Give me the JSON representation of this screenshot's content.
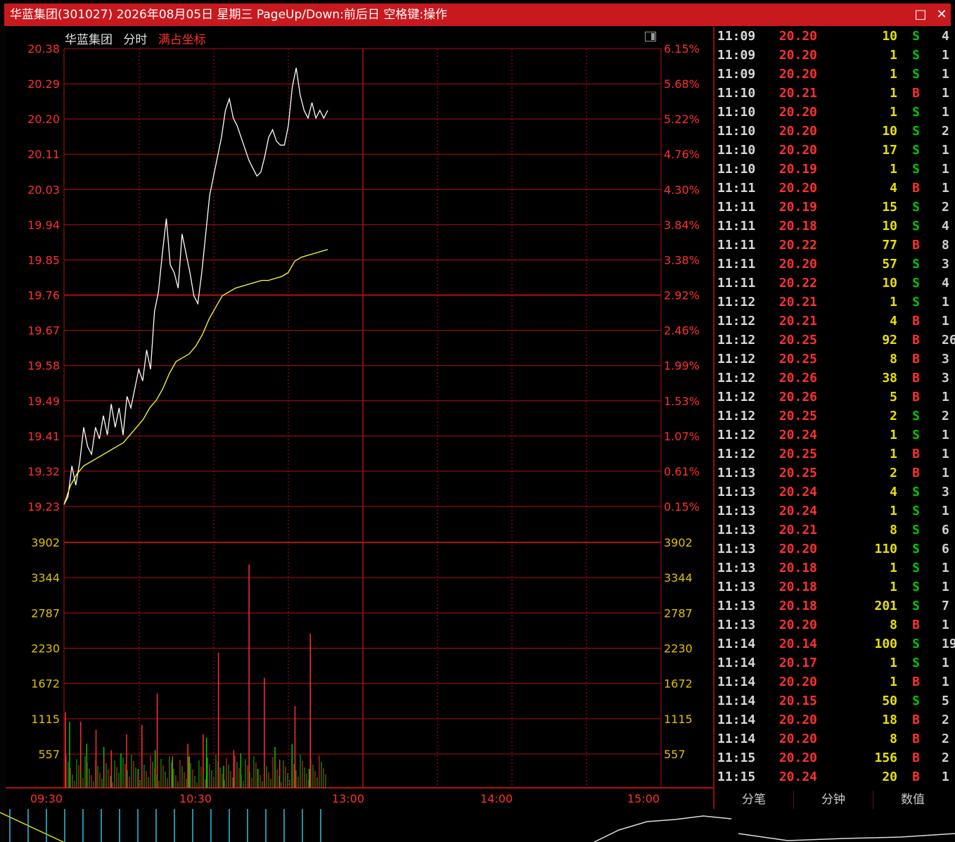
{
  "window": {
    "title": "华蓝集团(301027) 2026年08月05日 星期三 PageUp/Down:前后日 空格键:操作",
    "maximize_icon": "□",
    "close_icon": "✕"
  },
  "chart_header": {
    "name": "华蓝集团",
    "mode": "分时",
    "option": "满占坐标"
  },
  "colors": {
    "up": "#ff3030",
    "down": "#00c800",
    "price_line": "#ffffff",
    "avg_line": "#ffff30",
    "grid": "#b01010",
    "axis_text": "#ff3030",
    "vol_text": "#e0c000"
  },
  "chart_data": {
    "type": "line",
    "price_axis_labels": [
      "20.38",
      "20.29",
      "20.20",
      "20.11",
      "20.03",
      "19.94",
      "19.85",
      "19.76",
      "19.67",
      "19.58",
      "19.49",
      "19.41",
      "19.32",
      "19.23"
    ],
    "pct_axis_labels": [
      "6.15%",
      "5.68%",
      "5.22%",
      "4.76%",
      "4.30%",
      "3.84%",
      "3.38%",
      "2.92%",
      "2.46%",
      "1.99%",
      "1.53%",
      "1.07%",
      "0.61%",
      "0.15%"
    ],
    "volume_axis_labels": [
      "3902",
      "3344",
      "2787",
      "2230",
      "1672",
      "1115",
      "557"
    ],
    "time_labels": [
      "09:30",
      "10:30",
      "13:00",
      "14:00",
      "15:00"
    ],
    "ylim": [
      19.195,
      20.38
    ],
    "volume_max": 3902,
    "price": [
      19.2,
      19.22,
      19.3,
      19.25,
      19.31,
      19.4,
      19.35,
      19.33,
      19.4,
      19.37,
      19.43,
      19.38,
      19.46,
      19.4,
      19.45,
      19.38,
      19.48,
      19.45,
      19.5,
      19.55,
      19.52,
      19.6,
      19.55,
      19.7,
      19.75,
      19.85,
      19.94,
      19.82,
      19.8,
      19.76,
      19.9,
      19.85,
      19.8,
      19.74,
      19.72,
      19.8,
      19.9,
      20.0,
      20.05,
      20.1,
      20.15,
      20.22,
      20.25,
      20.2,
      20.18,
      20.15,
      20.12,
      20.09,
      20.07,
      20.05,
      20.06,
      20.1,
      20.15,
      20.17,
      20.14,
      20.13,
      20.13,
      20.18,
      20.28,
      20.33,
      20.26,
      20.22,
      20.2,
      20.24,
      20.2,
      20.22,
      20.2,
      20.22
    ],
    "avg": [
      19.2,
      19.25,
      19.28,
      19.3,
      19.31,
      19.32,
      19.33,
      19.34,
      19.35,
      19.36,
      19.38,
      19.4,
      19.42,
      19.45,
      19.47,
      19.5,
      19.54,
      19.57,
      19.58,
      19.59,
      19.61,
      19.64,
      19.68,
      19.71,
      19.74,
      19.75,
      19.76,
      19.765,
      19.77,
      19.775,
      19.78,
      19.78,
      19.785,
      19.79,
      19.8,
      19.83,
      19.84,
      19.845,
      19.85,
      19.855,
      19.86
    ],
    "volume_up": [
      1200,
      1050,
      920,
      600,
      850,
      1000,
      1500,
      500,
      700,
      850,
      2150,
      600,
      3550,
      1750,
      450,
      1300,
      2450
    ],
    "volume_down": [
      1050,
      700,
      650,
      550,
      300,
      600,
      450,
      500,
      800,
      350,
      550,
      300,
      650,
      700,
      300
    ]
  },
  "ticks": [
    {
      "time": "11:09",
      "price": "20.20",
      "vol": "10",
      "dir": "S",
      "num": "4"
    },
    {
      "time": "11:09",
      "price": "20.20",
      "vol": "1",
      "dir": "S",
      "num": "1"
    },
    {
      "time": "11:09",
      "price": "20.20",
      "vol": "1",
      "dir": "S",
      "num": "1"
    },
    {
      "time": "11:10",
      "price": "20.21",
      "vol": "1",
      "dir": "B",
      "num": "1"
    },
    {
      "time": "11:10",
      "price": "20.20",
      "vol": "1",
      "dir": "S",
      "num": "1"
    },
    {
      "time": "11:10",
      "price": "20.20",
      "vol": "10",
      "dir": "S",
      "num": "2"
    },
    {
      "time": "11:10",
      "price": "20.20",
      "vol": "17",
      "dir": "S",
      "num": "1"
    },
    {
      "time": "11:10",
      "price": "20.19",
      "vol": "1",
      "dir": "S",
      "num": "1"
    },
    {
      "time": "11:11",
      "price": "20.20",
      "vol": "4",
      "dir": "B",
      "num": "1"
    },
    {
      "time": "11:11",
      "price": "20.19",
      "vol": "15",
      "dir": "S",
      "num": "2"
    },
    {
      "time": "11:11",
      "price": "20.18",
      "vol": "10",
      "dir": "S",
      "num": "4"
    },
    {
      "time": "11:11",
      "price": "20.22",
      "vol": "77",
      "dir": "B",
      "num": "8"
    },
    {
      "time": "11:11",
      "price": "20.20",
      "vol": "57",
      "dir": "S",
      "num": "3"
    },
    {
      "time": "11:11",
      "price": "20.22",
      "vol": "10",
      "dir": "S",
      "num": "4"
    },
    {
      "time": "11:12",
      "price": "20.21",
      "vol": "1",
      "dir": "S",
      "num": "1"
    },
    {
      "time": "11:12",
      "price": "20.21",
      "vol": "4",
      "dir": "B",
      "num": "1"
    },
    {
      "time": "11:12",
      "price": "20.25",
      "vol": "92",
      "dir": "B",
      "num": "26"
    },
    {
      "time": "11:12",
      "price": "20.25",
      "vol": "8",
      "dir": "B",
      "num": "3"
    },
    {
      "time": "11:12",
      "price": "20.26",
      "vol": "38",
      "dir": "B",
      "num": "3"
    },
    {
      "time": "11:12",
      "price": "20.26",
      "vol": "5",
      "dir": "B",
      "num": "1"
    },
    {
      "time": "11:12",
      "price": "20.25",
      "vol": "2",
      "dir": "S",
      "num": "2"
    },
    {
      "time": "11:12",
      "price": "20.24",
      "vol": "1",
      "dir": "S",
      "num": "1"
    },
    {
      "time": "11:12",
      "price": "20.25",
      "vol": "1",
      "dir": "B",
      "num": "1"
    },
    {
      "time": "11:13",
      "price": "20.25",
      "vol": "2",
      "dir": "B",
      "num": "1"
    },
    {
      "time": "11:13",
      "price": "20.24",
      "vol": "4",
      "dir": "S",
      "num": "3"
    },
    {
      "time": "11:13",
      "price": "20.24",
      "vol": "1",
      "dir": "S",
      "num": "1"
    },
    {
      "time": "11:13",
      "price": "20.21",
      "vol": "8",
      "dir": "S",
      "num": "6"
    },
    {
      "time": "11:13",
      "price": "20.20",
      "vol": "110",
      "dir": "S",
      "num": "6"
    },
    {
      "time": "11:13",
      "price": "20.18",
      "vol": "1",
      "dir": "S",
      "num": "1"
    },
    {
      "time": "11:13",
      "price": "20.18",
      "vol": "1",
      "dir": "S",
      "num": "1"
    },
    {
      "time": "11:13",
      "price": "20.18",
      "vol": "201",
      "dir": "S",
      "num": "7"
    },
    {
      "time": "11:13",
      "price": "20.20",
      "vol": "8",
      "dir": "B",
      "num": "1"
    },
    {
      "time": "11:14",
      "price": "20.14",
      "vol": "100",
      "dir": "S",
      "num": "19"
    },
    {
      "time": "11:14",
      "price": "20.17",
      "vol": "1",
      "dir": "S",
      "num": "1"
    },
    {
      "time": "11:14",
      "price": "20.20",
      "vol": "1",
      "dir": "B",
      "num": "1"
    },
    {
      "time": "11:14",
      "price": "20.15",
      "vol": "50",
      "dir": "S",
      "num": "5"
    },
    {
      "time": "11:14",
      "price": "20.20",
      "vol": "18",
      "dir": "B",
      "num": "2"
    },
    {
      "time": "11:14",
      "price": "20.20",
      "vol": "8",
      "dir": "B",
      "num": "2"
    },
    {
      "time": "11:15",
      "price": "20.20",
      "vol": "156",
      "dir": "B",
      "num": "2"
    },
    {
      "time": "11:15",
      "price": "20.24",
      "vol": "20",
      "dir": "B",
      "num": "1"
    }
  ],
  "tabs": [
    "分笔",
    "分钟",
    "数值"
  ]
}
